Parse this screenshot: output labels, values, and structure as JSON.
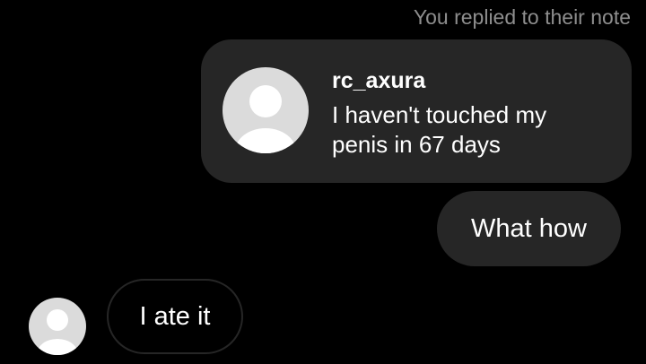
{
  "thread": {
    "reply_context": "You replied to their note",
    "note": {
      "username": "rc_axura",
      "text": "I haven't touched my penis in 67 days",
      "avatar_icon": "default-avatar-icon"
    },
    "messages": [
      {
        "direction": "sent",
        "text": "What how"
      },
      {
        "direction": "received",
        "text": "I ate it",
        "avatar_icon": "default-avatar-icon"
      }
    ]
  },
  "colors": {
    "background": "#000000",
    "bubble": "#262626",
    "muted_text": "#8e8e8e",
    "avatar_bg": "#dbdbdb",
    "avatar_fg": "#ffffff"
  }
}
